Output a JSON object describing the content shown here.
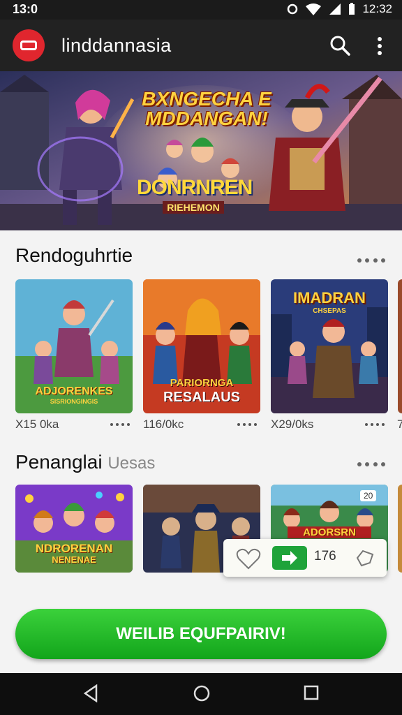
{
  "status_bar": {
    "time": "13:0",
    "clock": "12:32"
  },
  "app_bar": {
    "title": "linddannasia"
  },
  "banner": {
    "headline": "BXNGECHA E MDDANGAN!",
    "logo_top": "DONRNREN",
    "logo_bottom": "RIEHEMON"
  },
  "sections": [
    {
      "title": "Rendoguhrtie",
      "muted": "",
      "cards": [
        {
          "label_top": "ADJORENKES",
          "label_bottom": "SISRIONGINGIS",
          "meta": "X15 0ka"
        },
        {
          "label_top": "PARIORNGA",
          "label_bottom": "RESALAUS",
          "meta": "116/0kc"
        },
        {
          "label_top": "IMADRAN",
          "label_bottom": "CHSEPAS",
          "meta": "X29/0ks"
        },
        {
          "label_top": "",
          "label_bottom": "",
          "meta": "7"
        }
      ]
    },
    {
      "title": "Penanglai",
      "muted": "Uesas",
      "cards": [
        {
          "label_top": "NDRORENAN",
          "label_bottom": "NENENAE"
        },
        {
          "label_top": "",
          "label_bottom": ""
        },
        {
          "label_top": "ADORSRN",
          "label_bottom": "",
          "corner": "20"
        }
      ]
    }
  ],
  "popup": {
    "count": "176"
  },
  "cta": {
    "label": "WEILIB EQUFPAIRIV!"
  },
  "icons": [
    "app-logo-icon",
    "search-icon",
    "more-vert-icon",
    "heart-icon",
    "go-arrow-icon",
    "share-icon",
    "back-icon",
    "home-icon",
    "recents-icon"
  ]
}
